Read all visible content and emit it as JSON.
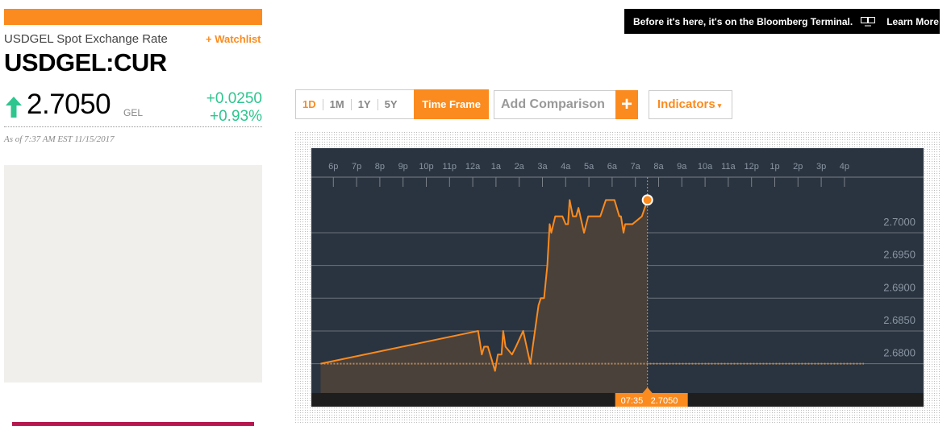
{
  "header": {
    "subtitle": "USDGEL Spot Exchange Rate",
    "watchlist": "+ Watchlist",
    "ticker": "USDGEL:CUR"
  },
  "quote": {
    "price": "2.7050",
    "currency": "GEL",
    "change": "+0.0250",
    "change_pct": "+0.93%",
    "as_of": "As of 7:37 AM EST 11/15/2017",
    "direction": "up"
  },
  "banner": {
    "text": "Before it's here, it's on the Bloomberg Terminal.",
    "icon": "terminal-monitor-icon",
    "link": "Learn More"
  },
  "controls": {
    "ranges": [
      "1D",
      "1M",
      "1Y",
      "5Y"
    ],
    "active_range": "1D",
    "time_frame": "Time Frame",
    "comparison_placeholder": "Add Comparison",
    "add": "+",
    "indicators": "Indicators",
    "indicators_caret": "▾"
  },
  "colors": {
    "accent": "#fb8b1e",
    "positive": "#2ec58f",
    "chart_bg": "#2a3440"
  },
  "chart_data": {
    "type": "area",
    "x_tick_labels": [
      "6p",
      "7p",
      "8p",
      "9p",
      "10p",
      "11p",
      "12a",
      "1a",
      "2a",
      "3a",
      "4a",
      "5a",
      "6a",
      "7a",
      "8a",
      "9a",
      "10a",
      "11a",
      "12p",
      "1p",
      "2p",
      "3p",
      "4p"
    ],
    "x_unit": "hours after 6p",
    "y_ticks": [
      "2.7000",
      "2.6950",
      "2.6900",
      "2.6850",
      "2.6800"
    ],
    "ylim": [
      2.6755,
      2.7085
    ],
    "previous_close": 2.68,
    "points": [
      [
        -0.55,
        2.68
      ],
      [
        6.23,
        2.685
      ],
      [
        6.39,
        2.6814
      ],
      [
        6.49,
        2.6826
      ],
      [
        6.65,
        2.6826
      ],
      [
        6.96,
        2.6789
      ],
      [
        7.08,
        2.6814
      ],
      [
        7.24,
        2.6814
      ],
      [
        7.31,
        2.685
      ],
      [
        7.41,
        2.6826
      ],
      [
        7.69,
        2.6814
      ],
      [
        7.86,
        2.6826
      ],
      [
        8.17,
        2.685
      ],
      [
        8.48,
        2.68
      ],
      [
        8.83,
        2.6889
      ],
      [
        8.93,
        2.69
      ],
      [
        9.07,
        2.69
      ],
      [
        9.21,
        2.695
      ],
      [
        9.31,
        2.7013
      ],
      [
        9.38,
        2.7
      ],
      [
        9.55,
        2.7025
      ],
      [
        9.86,
        2.7025
      ],
      [
        10.0,
        2.7013
      ],
      [
        10.1,
        2.7013
      ],
      [
        10.17,
        2.705
      ],
      [
        10.31,
        2.7025
      ],
      [
        10.45,
        2.7025
      ],
      [
        10.55,
        2.7038
      ],
      [
        10.79,
        2.7
      ],
      [
        10.97,
        2.7025
      ],
      [
        11.49,
        2.7025
      ],
      [
        11.73,
        2.705
      ],
      [
        12.1,
        2.705
      ],
      [
        12.31,
        2.7025
      ],
      [
        12.38,
        2.7025
      ],
      [
        12.49,
        2.7
      ],
      [
        12.56,
        2.7013
      ],
      [
        12.87,
        2.7013
      ],
      [
        13.28,
        2.7025
      ],
      [
        13.52,
        2.705
      ]
    ],
    "cursor": {
      "time": "07:35",
      "value": "2.7050"
    }
  }
}
